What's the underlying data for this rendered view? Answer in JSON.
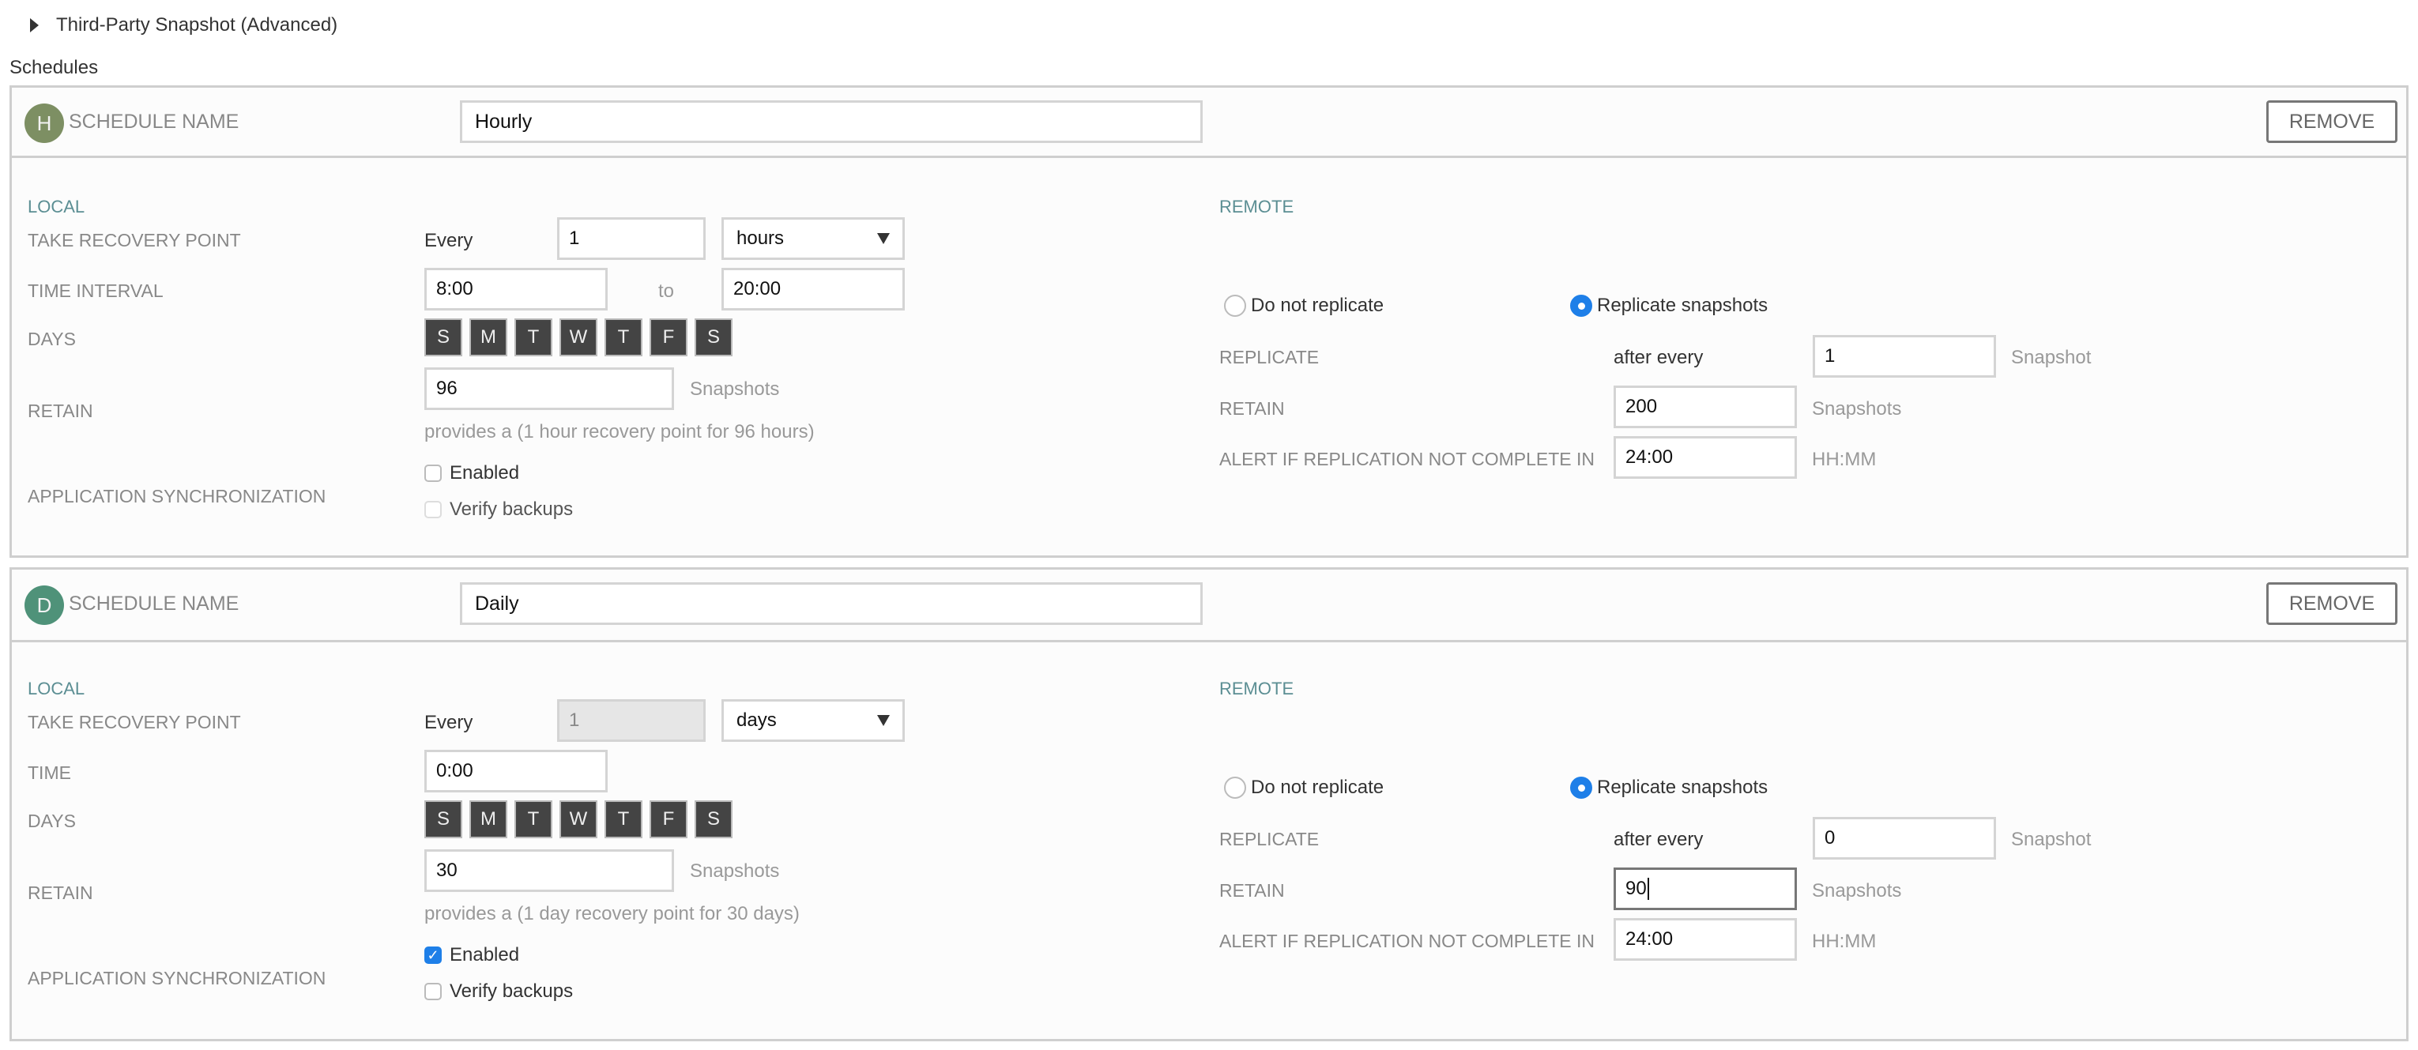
{
  "advanced_toggle": {
    "label": "Third-Party Snapshot (Advanced)",
    "icon": "caret-right-icon"
  },
  "schedules_title": "Schedules",
  "colors": {
    "accent_blue": "#1e7fe8",
    "section_title": "#5b8e93",
    "avatar_hourly": "#7d8f63",
    "avatar_daily": "#4f9279",
    "day_active": "#444444"
  },
  "schedules": [
    {
      "avatar_letter": "H",
      "name_label": "SCHEDULE NAME",
      "name_value": "Hourly",
      "remove_label": "REMOVE",
      "local": {
        "title": "LOCAL",
        "take_recovery_label": "TAKE RECOVERY POINT",
        "every_label": "Every",
        "every_value": "1",
        "unit_value": "hours",
        "time_label": "TIME INTERVAL",
        "time_from": "8:00",
        "time_to_label": "to",
        "time_to": "20:00",
        "days_label": "DAYS",
        "days": [
          "S",
          "M",
          "T",
          "W",
          "T",
          "F",
          "S"
        ],
        "retain_label": "RETAIN",
        "retain_value": "96",
        "retain_unit": "Snapshots",
        "retain_note": "provides a (1 hour recovery point for 96 hours)",
        "app_sync_label": "APPLICATION SYNCHRONIZATION",
        "enabled_label": "Enabled",
        "enabled_checked": false,
        "verify_label": "Verify backups",
        "verify_checked": false
      },
      "remote": {
        "title": "REMOTE",
        "do_not_replicate_label": "Do not replicate",
        "replicate_label": "Replicate snapshots",
        "selected": "Replicate snapshots",
        "replicate_row_label": "REPLICATE",
        "after_every_label": "after every",
        "after_every_value": "1",
        "after_every_unit": "Snapshot",
        "retain_label": "RETAIN",
        "retain_value": "200",
        "retain_unit": "Snapshots",
        "alert_label": "ALERT IF REPLICATION NOT COMPLETE IN",
        "alert_value": "24:00",
        "alert_unit": "HH:MM"
      }
    },
    {
      "avatar_letter": "D",
      "name_label": "SCHEDULE NAME",
      "name_value": "Daily",
      "remove_label": "REMOVE",
      "local": {
        "title": "LOCAL",
        "take_recovery_label": "TAKE RECOVERY POINT",
        "every_label": "Every",
        "every_value": "1",
        "unit_value": "days",
        "time_label": "TIME",
        "time_from": "0:00",
        "days_label": "DAYS",
        "days": [
          "S",
          "M",
          "T",
          "W",
          "T",
          "F",
          "S"
        ],
        "retain_label": "RETAIN",
        "retain_value": "30",
        "retain_unit": "Snapshots",
        "retain_note": "provides a (1 day recovery point for 30 days)",
        "app_sync_label": "APPLICATION SYNCHRONIZATION",
        "enabled_label": "Enabled",
        "enabled_checked": true,
        "verify_label": "Verify backups",
        "verify_checked": false
      },
      "remote": {
        "title": "REMOTE",
        "do_not_replicate_label": "Do not replicate",
        "replicate_label": "Replicate snapshots",
        "selected": "Replicate snapshots",
        "replicate_row_label": "REPLICATE",
        "after_every_label": "after every",
        "after_every_value": "0",
        "after_every_unit": "Snapshot",
        "retain_label": "RETAIN",
        "retain_value": "90",
        "retain_unit": "Snapshots",
        "alert_label": "ALERT IF REPLICATION NOT COMPLETE IN",
        "alert_value": "24:00",
        "alert_unit": "HH:MM"
      }
    }
  ]
}
